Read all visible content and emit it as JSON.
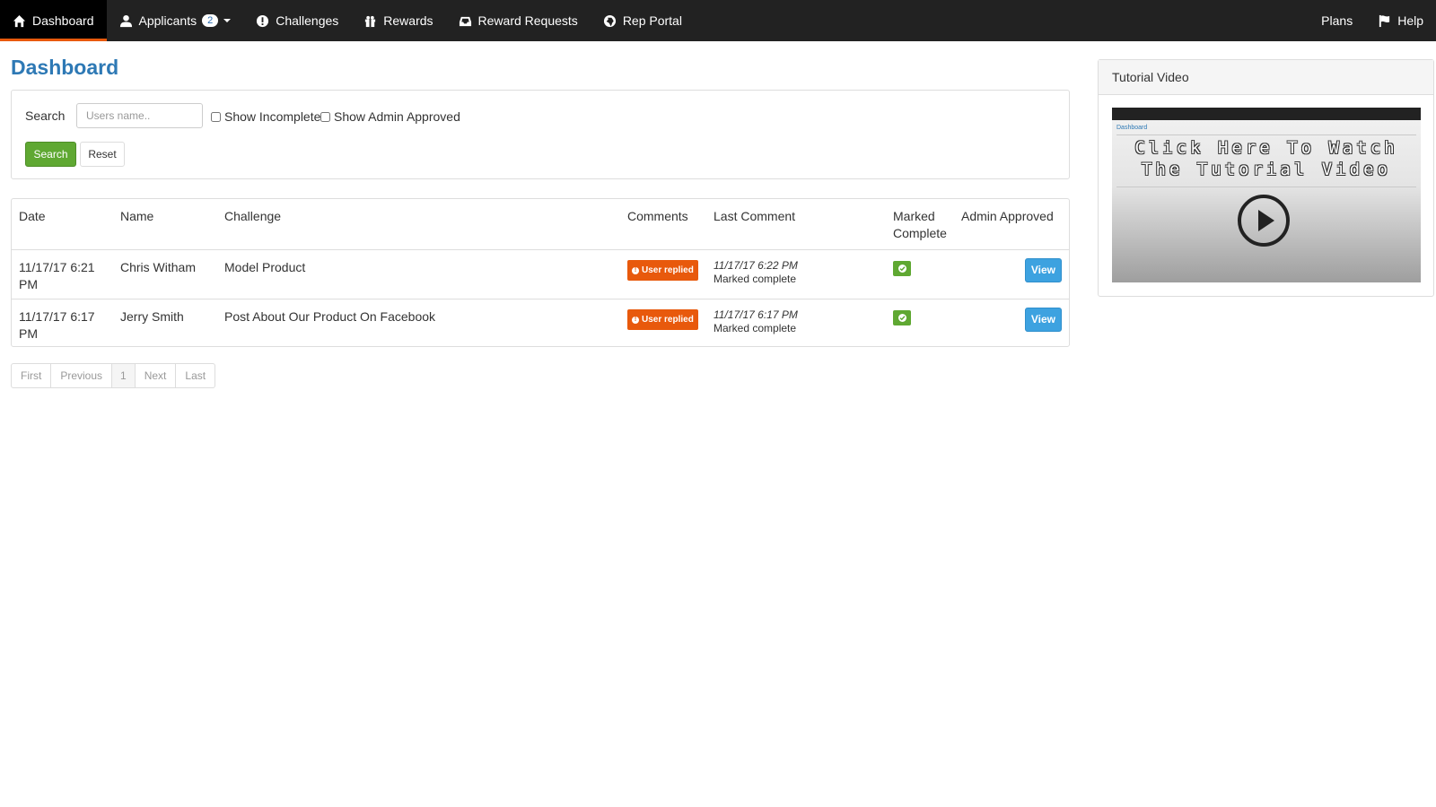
{
  "nav": {
    "items": [
      {
        "label": "Dashboard",
        "icon": "home-icon"
      },
      {
        "label": "Applicants",
        "icon": "user-icon",
        "badge": "2"
      },
      {
        "label": "Challenges",
        "icon": "exclamation-circle-icon"
      },
      {
        "label": "Rewards",
        "icon": "gift-icon"
      },
      {
        "label": "Reward Requests",
        "icon": "inbox-icon"
      },
      {
        "label": "Rep Portal",
        "icon": "globe-icon"
      }
    ],
    "right": [
      {
        "label": "Plans"
      },
      {
        "label": "Help",
        "icon": "flag-icon"
      }
    ],
    "active_color": "#e8590c"
  },
  "page": {
    "title": "Dashboard"
  },
  "search": {
    "label": "Search",
    "placeholder": "Users name..",
    "show_incomplete": "Show Incomplete",
    "show_admin_approved": "Show Admin Approved",
    "search_button": "Search",
    "reset_button": "Reset"
  },
  "table": {
    "headers": [
      "Date",
      "Name",
      "Challenge",
      "Comments",
      "Last Comment",
      "Marked Complete",
      "Admin Approved"
    ],
    "rows": [
      {
        "date": "11/17/17 6:21 PM",
        "name": "Chris Witham",
        "challenge": "Model Product",
        "comment_badge": "User replied",
        "last_comment_date": "11/17/17 6:22 PM",
        "last_comment_text": "Marked complete",
        "marked_complete": true,
        "action": "View"
      },
      {
        "date": "11/17/17 6:17 PM",
        "name": "Jerry Smith",
        "challenge": "Post About Our Product On Facebook",
        "comment_badge": "User replied",
        "last_comment_date": "11/17/17 6:17 PM",
        "last_comment_text": "Marked complete",
        "marked_complete": true,
        "action": "View"
      }
    ]
  },
  "pagination": [
    "First",
    "Previous",
    "1",
    "Next",
    "Last"
  ],
  "tutorial": {
    "title": "Tutorial Video",
    "caption_line1": "Click Here To Watch",
    "caption_line2": "The Tutorial Video",
    "preview_title": "Dashboard"
  }
}
